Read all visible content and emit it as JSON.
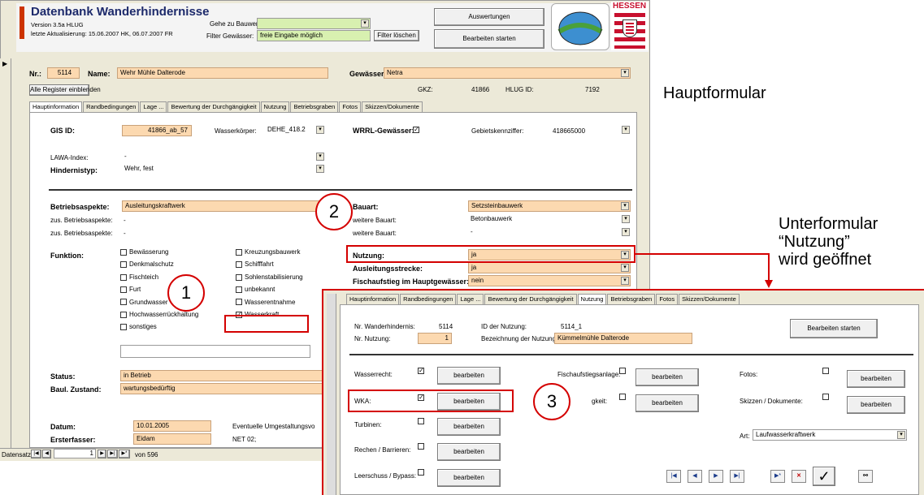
{
  "header": {
    "title": "Datenbank Wanderhindernisse",
    "version": "Version 3.5a HLUG",
    "last_update": "letzte Aktualisierung: 15.06.2007 HK, 06.07.2007 FR",
    "goto_label": "Gehe zu Bauwerk:",
    "filter_label": "Filter Gewässer:",
    "filter_value": "freie Eingabe möglich",
    "filter_clear": "Filter löschen",
    "btn_eval": "Auswertungen",
    "btn_edit": "Bearbeiten starten",
    "logo_text": "HESSEN"
  },
  "record": {
    "nr_label": "Nr.:",
    "nr": "5114",
    "name_label": "Name:",
    "name": "Wehr Mühle Dalterode",
    "gew_label": "Gewässer:",
    "gew": "Netra",
    "gkz_label": "GKZ:",
    "gkz": "41866",
    "hlug_label": "HLUG ID:",
    "hlug": "7192",
    "show_all": "Alle Register einblenden"
  },
  "tabs": [
    "Hauptinformation",
    "Randbedingungen",
    "Lage ...",
    "Bewertung der Durchgängigkeit",
    "Nutzung",
    "Betriebsgraben",
    "Fotos",
    "Skizzen/Dokumente"
  ],
  "main": {
    "gis_label": "GIS ID:",
    "gis": "41866_ab_57",
    "wk_label": "Wasserkörper:",
    "wk": "DEHE_418.2",
    "wrrl_label": "WRRL-Gewässer:",
    "gebiet_label": "Gebietskennziffer:",
    "gebiet": "418665000",
    "lawa_label": "LAWA-Index:",
    "lawa": "-",
    "typ_label": "Hindernistyp:",
    "typ": "Wehr, fest",
    "betr_label": "Betriebsaspekte:",
    "betr": "Ausleitungskraftwerk",
    "zus1_label": "zus. Betriebsaspekte:",
    "zus1": "-",
    "zus2_label": "zus. Betriebsaspekte:",
    "zus2": "-",
    "bauart_label": "Bauart:",
    "bauart": "Setzsteinbauwerk",
    "wbauart1_label": "weitere Bauart:",
    "wbauart1": "Betonbauwerk",
    "wbauart2_label": "weitere Bauart:",
    "wbauart2": "-",
    "nutzung_label": "Nutzung:",
    "nutzung": "ja",
    "ausl_label": "Ausleitungsstrecke:",
    "ausl": "ja",
    "fisch_label": "Fischaufstieg im Hauptgewässer:",
    "fisch": "nein",
    "funktion_label": "Funktion:",
    "func_col1": [
      "Bewässerung",
      "Denkmalschutz",
      "Fischteich",
      "Furt",
      "Grundwasser",
      "Hochwasserrückhaltung",
      "sonstiges"
    ],
    "func_col2": [
      "Kreuzungsbauwerk",
      "Schifffahrt",
      "Sohlenstabilisierung",
      "unbekannt",
      "Wasserentnahme",
      "Wasserkraft"
    ],
    "status_label": "Status:",
    "status": "in Betrieb",
    "zust_label": "Baul. Zustand:",
    "zust": "wartungsbedürftig",
    "datum_label": "Datum:",
    "datum": "10.01.2005",
    "umg_label": "Eventuelle Umgestaltungsvo",
    "erst_label": "Ersterfasser:",
    "erst": "Eidam",
    "net": "NET 02;",
    "nav_label": "Datensatz:",
    "nav_pos": "1",
    "nav_total": "von 596"
  },
  "sub": {
    "nr_label": "Nr. Wanderhindernis:",
    "nr": "5114",
    "id_label": "ID der Nutzung:",
    "id": "5114_1",
    "nutz_label": "Nr. Nutzung:",
    "nutz": "1",
    "bez_label": "Bezeichnung der Nutzung:",
    "bez": "Kümmelmühle Dalterode",
    "btn_edit": "Bearbeiten starten",
    "edit": "bearbeiten",
    "wasserrecht": "Wasserrecht:",
    "wka": "WKA:",
    "turbinen": "Turbinen:",
    "rechen": "Rechen / Barrieren:",
    "leer": "Leerschuss / Bypass:",
    "fischanlage": "Fischaufstiegsanlage:",
    "keit": "gkeit:",
    "fotos": "Fotos:",
    "skizzen": "Skizzen / Dokumente:",
    "art_label": "Art:",
    "art": "Laufwasserkraftwerk"
  },
  "annotations": {
    "main": "Hauptformular",
    "sub1": "Unterformular",
    "sub2": "“Nutzung”",
    "sub3": "wird geöffnet",
    "c1": "1",
    "c2": "2",
    "c3": "3"
  }
}
